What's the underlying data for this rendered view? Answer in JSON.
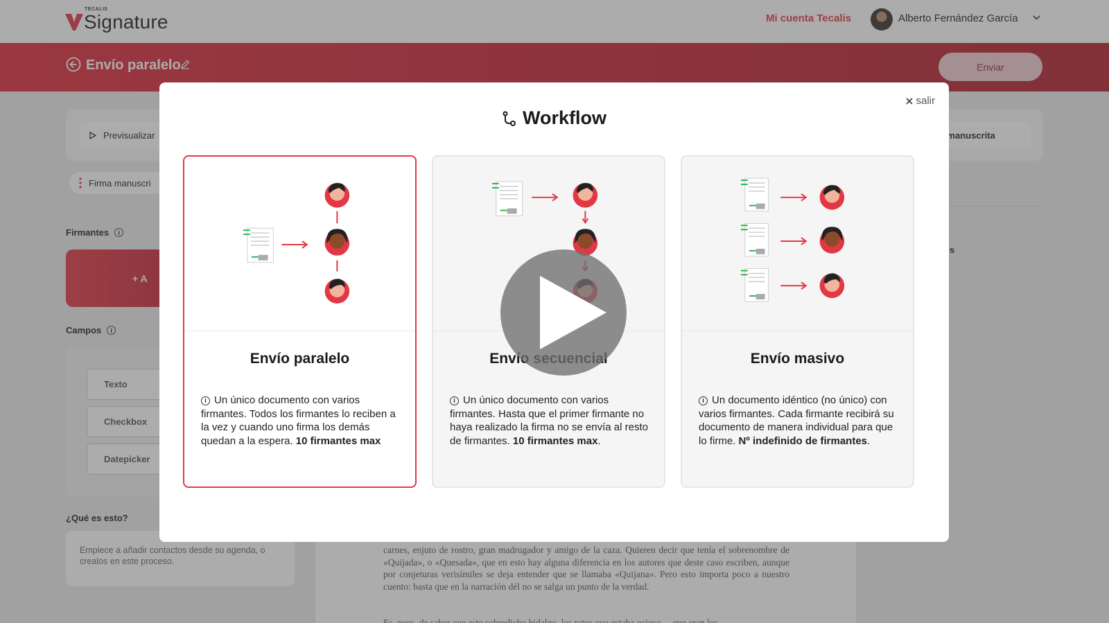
{
  "header": {
    "brand_small": "TECALIS",
    "brand_name": "Signature",
    "account_link": "Mi cuenta Tecalis",
    "user_name": "Alberto Fernández García"
  },
  "subbar": {
    "title": "Envío paralelo",
    "send_label": "Enviar"
  },
  "page": {
    "preview_label": "Previsualizar",
    "signature_type_right": "ma manuscrita",
    "signature_pill": "Firma manuscri",
    "signers_label": "Firmantes",
    "add_label": "+ A",
    "fields_label": "Campos",
    "fields": [
      "Texto",
      "Checkbox",
      "Datepicker"
    ],
    "help_title": "¿Qué es esto?",
    "help_text": "Empiece a añadir contactos desde su agenda, o crealos en este proceso.",
    "right_label": "os",
    "document_text": "carnes, enjuto de rostro, gran madrugador y amigo de la caza. Quieren decir que tenía el sobrenombre de «Quijada», o «Quesada», que en esto hay alguna diferencia en los autores que deste caso escriben, aunque por conjeturas verisímiles se deja entender que se llamaba «Quijana». Pero esto importa poco a nuestro cuento: basta que en la narración dél no se salga un punto de la verdad.",
    "document_text_2": "Es, pues, de saber que este sobredicho hidalgo, los ratos que estaba ocioso —que eran los"
  },
  "modal": {
    "title": "Workflow",
    "close_label": "salir",
    "options": [
      {
        "title": "Envío paralelo",
        "desc_text": "Un único documento con varios firmantes. Todos los firmantes lo reciben a la vez y cuando uno firma los demás quedan a la espera.",
        "desc_bold": "10 firmantes max",
        "desc_suffix": "",
        "selected": true
      },
      {
        "title": "Envío secuencial",
        "desc_text": "Un único documento con varios firmantes. Hasta que el primer firmante no haya realizado la firma no se envía al resto de firmantes.",
        "desc_bold": "10 firmantes max",
        "desc_suffix": ".",
        "selected": false
      },
      {
        "title": "Envío masivo",
        "desc_text": "Un documento idéntico (no único) con varios firmantes. Cada firmante recibirá su documento de manera individual para que lo firme.",
        "desc_bold": "Nº indefinido de firmantes",
        "desc_suffix": ".",
        "selected": false
      }
    ]
  },
  "icons": {
    "play": "play-icon",
    "workflow": "workflow-icon",
    "close": "close-icon"
  },
  "colors": {
    "brand_red": "#e23845",
    "subbar_red": "#c42434",
    "selected_border": "#e23845"
  }
}
